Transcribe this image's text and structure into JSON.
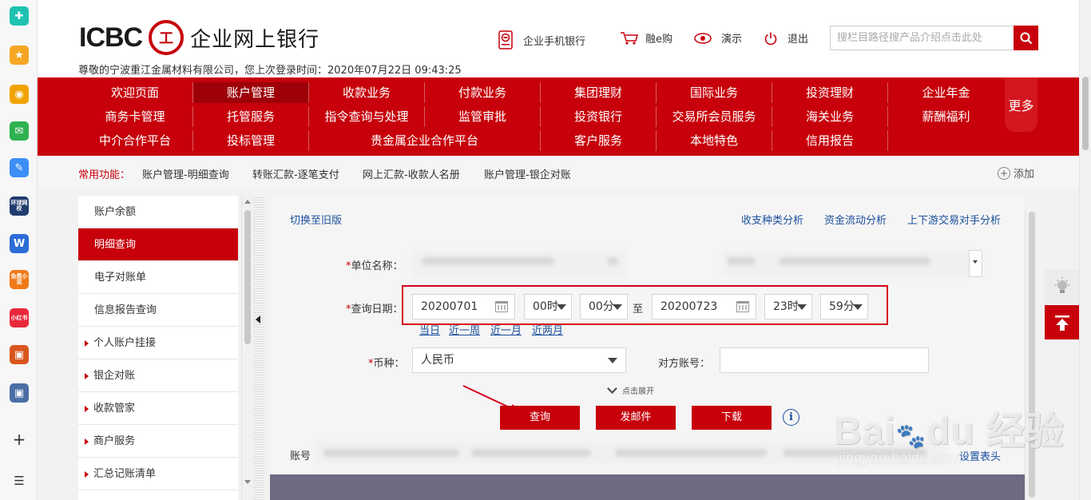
{
  "launcher": {
    "apps": [
      {
        "name": "plus-app-icon",
        "color": "#1ec2b0",
        "glyph": "✚"
      },
      {
        "name": "star-app-icon",
        "color": "#f5a623",
        "glyph": "★"
      },
      {
        "name": "weibo-app-icon",
        "color": "#f0a300",
        "glyph": "◉"
      },
      {
        "name": "mail-app-icon",
        "color": "#2fb14f",
        "glyph": "✉"
      },
      {
        "name": "doc-edit-app-icon",
        "color": "#3d8ef7",
        "glyph": "✎"
      },
      {
        "name": "news-app-icon",
        "color": "#1f3c6e",
        "glyph": "环球网校"
      },
      {
        "name": "word-app-icon",
        "color": "#2b6cd6",
        "glyph": "W"
      },
      {
        "name": "novel-app-icon",
        "color": "#f07a1a",
        "glyph": "免费小说"
      },
      {
        "name": "xiaohongshu-app-icon",
        "color": "#e8283a",
        "glyph": "小红书"
      },
      {
        "name": "game-app-icon",
        "color": "#d8561e",
        "glyph": "▣"
      },
      {
        "name": "game2-app-icon",
        "color": "#4a6fa5",
        "glyph": "▣"
      }
    ],
    "add_glyph": "+",
    "list_glyph": "☰"
  },
  "header": {
    "logo_text": "ICBC",
    "logo_seal": "工",
    "logo_cn": "企业网上银行",
    "welcome": "尊敬的宁波重江金属材料有限公司，您上次登录时间：2020年07月22日 09:43:25",
    "links": {
      "mobile": "企业手机银行",
      "emall": "融e购",
      "demo": "演示",
      "logout": "退出"
    },
    "search_placeholder": "搜栏目路径搜产品介绍点击此处"
  },
  "nav": {
    "row1": [
      "欢迎页面",
      "账户管理",
      "收款业务",
      "付款业务",
      "集团理财",
      "国际业务",
      "投资理财",
      "企业年金"
    ],
    "row2": [
      "商务卡管理",
      "托管服务",
      "指令查询与处理",
      "监管审批",
      "投资银行",
      "交易所会员服务",
      "海关业务",
      "薪酬福利"
    ],
    "row3": [
      "中介合作平台",
      "投标管理",
      "贵金属企业合作平台",
      "客户服务",
      "本地特色",
      "信用报告"
    ],
    "more": "更多",
    "active": "账户管理"
  },
  "common": {
    "label": "常用功能：",
    "links": [
      "账户管理-明细查询",
      "转账汇款-逐笔支付",
      "网上汇款-收款人名册",
      "账户管理-银企对账"
    ],
    "add": "添加"
  },
  "leftmenu": {
    "items": [
      {
        "label": "账户余额",
        "arrow": false,
        "active": false
      },
      {
        "label": "明细查询",
        "arrow": false,
        "active": true
      },
      {
        "label": "电子对账单",
        "arrow": false,
        "active": false
      },
      {
        "label": "信息报告查询",
        "arrow": false,
        "active": false
      },
      {
        "label": "个人账户挂接",
        "arrow": true,
        "active": false
      },
      {
        "label": "银企对账",
        "arrow": true,
        "active": false
      },
      {
        "label": "收款管家",
        "arrow": true,
        "active": false
      },
      {
        "label": "商户服务",
        "arrow": true,
        "active": false
      },
      {
        "label": "汇总记账清单",
        "arrow": true,
        "active": false
      }
    ]
  },
  "main": {
    "switch_old": "切换至旧版",
    "analysis": [
      "收支种类分析",
      "资金流动分析",
      "上下游交易对手分析"
    ],
    "unit_label": "单位名称：",
    "date_label": "查询日期：",
    "date_from": "20200701",
    "hour_from": "00时",
    "minute_from": "00分",
    "to": "至",
    "date_to": "20200723",
    "hour_to": "23时",
    "minute_to": "59分",
    "quick": [
      "当日",
      "近一周",
      "近一月",
      "近两月"
    ],
    "currency_label": "币种：",
    "currency_value": "人民币",
    "counterparty_label": "对方账号：",
    "expand": "点击展开",
    "buttons": {
      "query": "查询",
      "email": "发邮件",
      "download": "下载"
    },
    "info": "i",
    "account_label": "账号",
    "set_header": "设置表头"
  },
  "watermark": {
    "brand": "Bai",
    "brand2": "du",
    "cn": "经验",
    "url": "jingyan.baidu.com"
  },
  "colors": {
    "brand_red": "#c7000b",
    "link_blue": "#1b4f9c",
    "table_header": "#6e6b82"
  }
}
